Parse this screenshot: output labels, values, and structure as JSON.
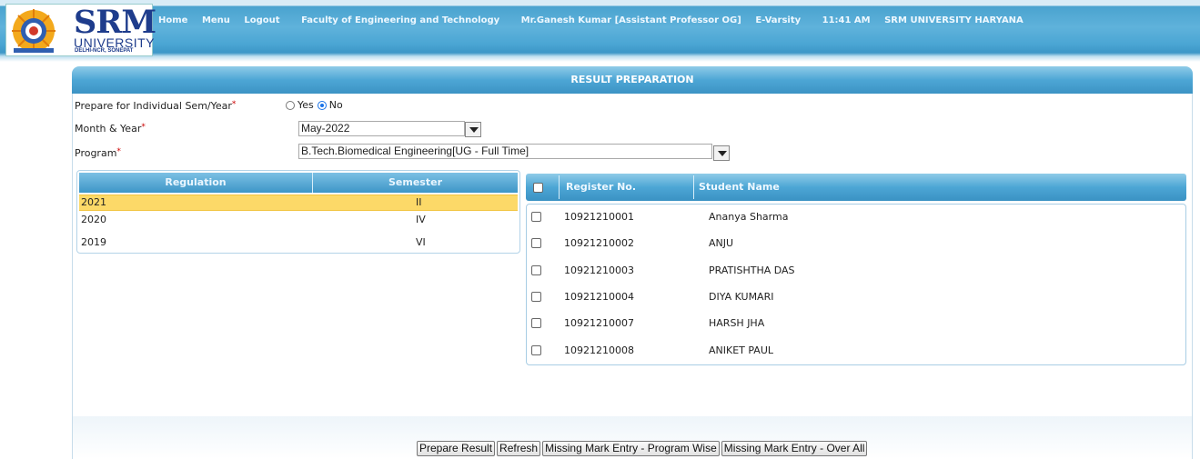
{
  "header": {
    "logo": {
      "main_text": "SRM",
      "sub_text": "UNIVERSITY",
      "campus_text": "DELHI-NCR, SONEPAT"
    },
    "nav": {
      "home": "Home",
      "menu": "Menu",
      "logout": "Logout",
      "faculty": "Faculty of Engineering and Technology",
      "user": "Mr.Ganesh Kumar [Assistant Professor OG]",
      "portal": "E-Varsity",
      "time": "11:41 AM",
      "university": "SRM UNIVERSITY HARYANA"
    }
  },
  "panel": {
    "title": "RESULT PREPARATION"
  },
  "form": {
    "individual_label": "Prepare for Individual Sem/Year",
    "yes_label": "Yes",
    "no_label": "No",
    "selected_option": "No",
    "month_year_label": "Month & Year",
    "month_year_value": "May-2022",
    "program_label": "Program",
    "program_value": "B.Tech.Biomedical Engineering[UG - Full Time]",
    "required_mark": "*"
  },
  "regulation_table": {
    "headers": {
      "regulation": "Regulation",
      "semester": "Semester"
    },
    "rows": [
      {
        "regulation": "2021",
        "semester": "II",
        "selected": true
      },
      {
        "regulation": "2020",
        "semester": "IV",
        "selected": false
      },
      {
        "regulation": "2019",
        "semester": "VI",
        "selected": false
      }
    ]
  },
  "student_table": {
    "headers": {
      "register_no": "Register No.",
      "student_name": "Student Name"
    },
    "rows": [
      {
        "register_no": "10921210001",
        "student_name": "Ananya Sharma"
      },
      {
        "register_no": "10921210002",
        "student_name": "ANJU"
      },
      {
        "register_no": "10921210003",
        "student_name": "PRATISHTHA DAS"
      },
      {
        "register_no": "10921210004",
        "student_name": "DIYA KUMARI"
      },
      {
        "register_no": "10921210007",
        "student_name": "HARSH JHA"
      },
      {
        "register_no": "10921210008",
        "student_name": "ANIKET PAUL"
      }
    ]
  },
  "buttons": {
    "prepare": "Prepare Result",
    "refresh": "Refresh",
    "missing_program": "Missing Mark Entry - Program Wise",
    "missing_all": "Missing Mark Entry - Over All"
  },
  "colors": {
    "header_blue": "#4da6d5",
    "selected_row": "#fcd968",
    "logo_blue": "#1e3c8c",
    "required_red": "#cc0000"
  },
  "icons": {
    "seal": "university-seal-icon",
    "dropdown": "chevron-down-icon"
  }
}
